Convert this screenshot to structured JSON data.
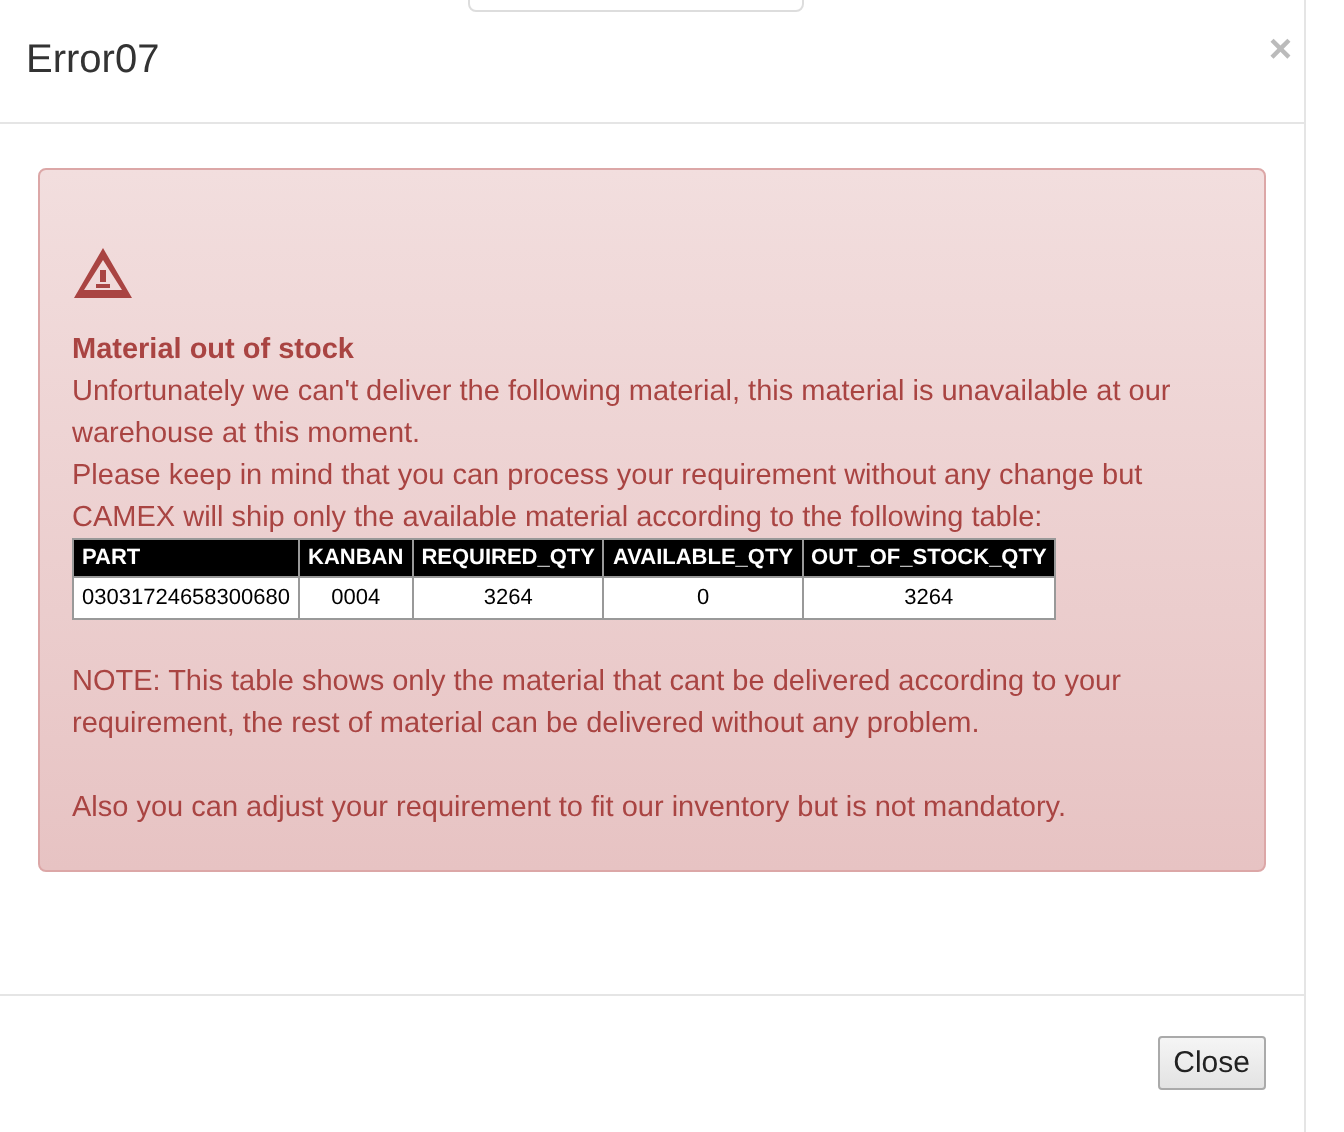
{
  "dialog": {
    "title": "Error07",
    "close_icon": "×"
  },
  "alert": {
    "heading": "Material out of stock",
    "lines": [
      "Unfortunately we can't deliver the following material, this material is unavailable at our warehouse at this moment.",
      "Please keep in mind that you can process your requirement without any change but CAMEX will ship only the available material according to the following table:"
    ],
    "table": {
      "columns": [
        "PART",
        "KANBAN",
        "REQUIRED_QTY",
        "AVAILABLE_QTY",
        "OUT_OF_STOCK_QTY"
      ],
      "rows": [
        [
          "03031724658300680",
          "0004",
          "3264",
          "0",
          "3264"
        ]
      ]
    },
    "notes": [
      "NOTE: This table shows only the material that cant be delivered according to your requirement, the rest of material can be delivered without any problem.",
      "Also you can adjust your requirement to fit our inventory but is not mandatory."
    ]
  },
  "buttons": [
    "Close"
  ]
}
